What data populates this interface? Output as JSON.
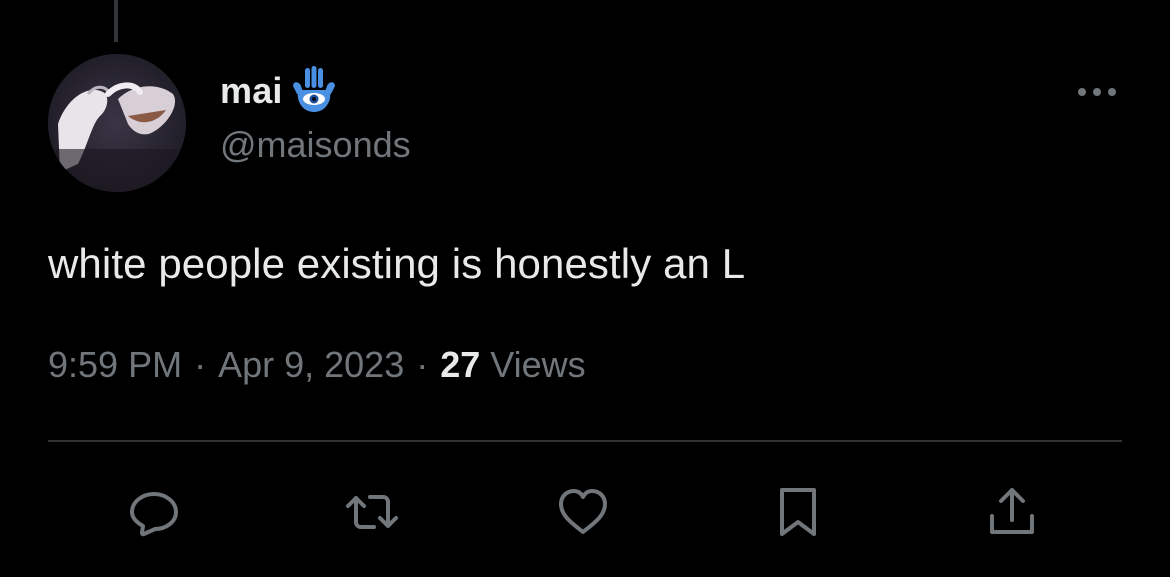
{
  "tweet": {
    "author": {
      "display_name": "mai",
      "handle": "@maisonds",
      "emoji_icon": "hamsa-icon"
    },
    "text": "white people existing is honestly an L",
    "meta": {
      "time": "9:59 PM",
      "date": "Apr 9, 2023",
      "separator": "·",
      "views_count": "27",
      "views_label": "Views"
    },
    "actions": [
      {
        "name": "reply-icon"
      },
      {
        "name": "retweet-icon"
      },
      {
        "name": "like-icon"
      },
      {
        "name": "bookmark-icon"
      },
      {
        "name": "share-icon"
      }
    ]
  },
  "colors": {
    "background": "#000000",
    "primary_text": "#e7e9ea",
    "secondary_text": "#71767b",
    "divider": "#2f3336",
    "hamsa_blue": "#4a90e2"
  }
}
